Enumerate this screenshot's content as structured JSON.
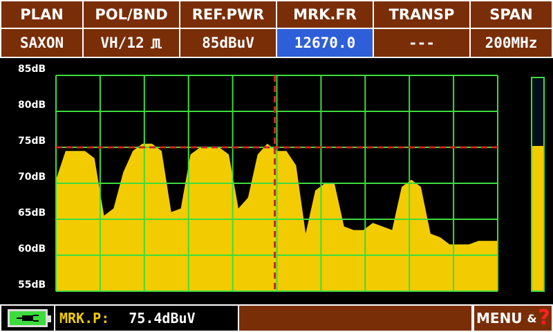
{
  "header": {
    "columns": [
      {
        "label": "PLAN",
        "value": "SAXON",
        "selected": false
      },
      {
        "label": "POL/BND",
        "value": "VH/12",
        "selected": false,
        "icon": "band-pulse-icon"
      },
      {
        "label": "REF.PWR",
        "value": "85dBuV",
        "selected": false
      },
      {
        "label": "MRK.FR",
        "value": "12670.0",
        "selected": true
      },
      {
        "label": "TRANSP",
        "value": "---",
        "selected": false
      },
      {
        "label": "SPAN",
        "value": "200MHz",
        "selected": false
      }
    ]
  },
  "spectrum": {
    "y_ticks": [
      "85dB",
      "80dB",
      "75dB",
      "70dB",
      "65dB",
      "60dB",
      "55dB"
    ],
    "y_range_db": [
      55,
      85
    ],
    "grid_columns": 10,
    "grid_rows": 6,
    "marker_level_db": 75,
    "marker_position_fraction": 0.5,
    "trace_db": [
      70.5,
      74.5,
      74.5,
      74.5,
      73.5,
      65.5,
      66.5,
      71.5,
      74.5,
      75.5,
      75.5,
      74.5,
      66,
      66.5,
      74,
      75,
      75,
      75,
      74,
      66.5,
      68,
      74,
      75.5,
      74.5,
      74.5,
      72.5,
      63,
      69,
      70,
      70,
      64,
      63.5,
      63.5,
      64.5,
      64,
      63.5,
      69.5,
      70.5,
      69.5,
      63,
      62.5,
      61.5,
      61.5,
      61.5,
      62,
      62,
      62
    ],
    "colors": {
      "grid": "#3ddc3d",
      "trace": "#f2cc00",
      "marker": "#d82020"
    }
  },
  "level_bar": {
    "level_fraction": 0.68
  },
  "footer": {
    "marker_label": "MRK.P:",
    "marker_value": "75.4dBuV",
    "menu_label": "MENU",
    "menu_amp": "&",
    "menu_help": "?"
  },
  "icons": {
    "battery": "battery-charging-icon",
    "help": "help-icon"
  }
}
